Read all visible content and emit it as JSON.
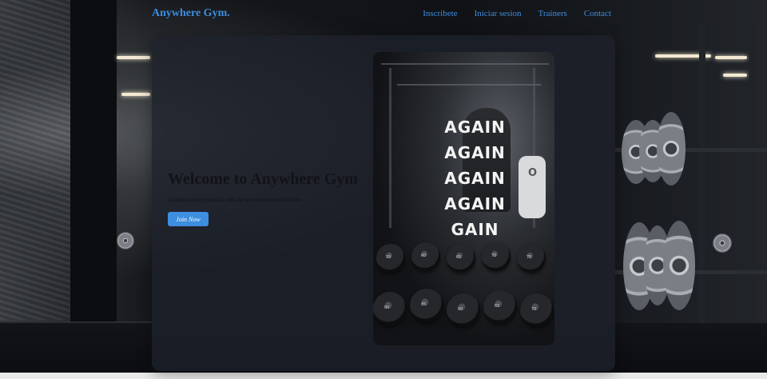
{
  "nav": {
    "brand": "Anywhere Gym.",
    "links": [
      "Inscribete",
      "Iniciar sesion",
      "Trainers",
      "Contact"
    ]
  },
  "hero": {
    "title": "Welcome to Anywhere Gym",
    "subtitle": "Transform your potential with the best trainers and facilities.",
    "cta": "Join Now"
  },
  "poster": {
    "words": [
      "AGAIN",
      "AGAIN",
      "AGAIN",
      "AGAIN",
      "GAIN"
    ],
    "shirt_text": "O",
    "dumbbell_labels": [
      "55",
      "60",
      "65",
      "70",
      "75",
      "80",
      "85",
      "60",
      "65",
      "70"
    ]
  },
  "colors": {
    "accent": "#3d8ee0",
    "card": "#1e212c",
    "poster_text": "#f4f4f4"
  }
}
